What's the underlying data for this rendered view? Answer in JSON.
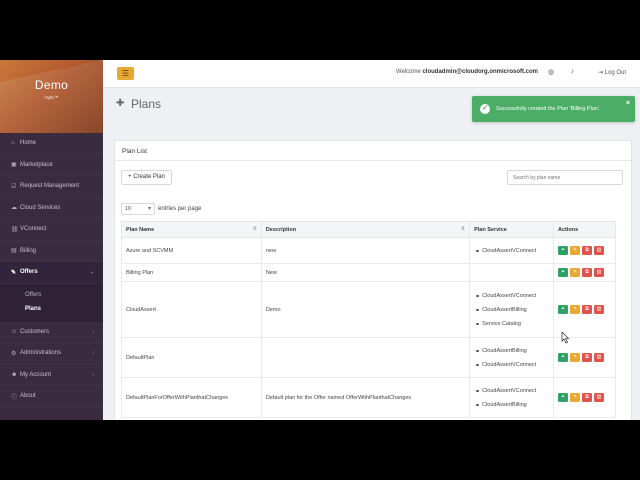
{
  "brand": {
    "title": "Demo",
    "subtitle": "Hybr™"
  },
  "sidebar": {
    "items": [
      {
        "label": "Home",
        "icon": "home-icon",
        "glyph": "⌂"
      },
      {
        "label": "Marketplace",
        "icon": "shopping-bag-icon",
        "glyph": "▣"
      },
      {
        "label": "Request Management",
        "icon": "check-square-icon",
        "glyph": "☑"
      },
      {
        "label": "Cloud Services",
        "icon": "cloud-icon",
        "glyph": "☁"
      },
      {
        "label": "VConnect",
        "icon": "link-icon",
        "glyph": "⛓"
      },
      {
        "label": "Billing",
        "icon": "billing-icon",
        "glyph": "▤"
      },
      {
        "label": "Offers",
        "icon": "tag-icon",
        "glyph": "✎"
      }
    ],
    "offers_sub": [
      "Offers",
      "Plans"
    ],
    "items_after": [
      {
        "label": "Customers",
        "icon": "users-icon",
        "glyph": "☺"
      },
      {
        "label": "Administrations",
        "icon": "admin-icon",
        "glyph": "⚙"
      },
      {
        "label": "My Account",
        "icon": "user-icon",
        "glyph": "☻"
      },
      {
        "label": "About",
        "icon": "info-icon",
        "glyph": "ⓘ"
      }
    ]
  },
  "topbar": {
    "welcome_prefix": "Welcome",
    "user": "cloudadmin@cloudorg.onmicrosoft.com",
    "logout": "Log Out"
  },
  "page": {
    "title": "Plans"
  },
  "toast": {
    "message": "Successfully created the Plan 'Billing Plan'.",
    "close": "×"
  },
  "panel": {
    "title": "Plan List",
    "create_button": "Create Plan",
    "search_placeholder": "Search by plan name",
    "entries_value": "10",
    "entries_label": "entries per page"
  },
  "table": {
    "headers": [
      "Plan Name",
      "Description",
      "Plan Service",
      "Actions"
    ],
    "rows": [
      {
        "name": "Azure and SCVMM",
        "description": "new",
        "services": [
          "CloudAssertVConnect"
        ]
      },
      {
        "name": "Billing Plan",
        "description": "New",
        "services": []
      },
      {
        "name": "CloudAssert",
        "description": "Demo",
        "services": [
          "CloudAssertVConnect",
          "CloudAssertBilling",
          "Service Catalog"
        ]
      },
      {
        "name": "DefaultPlan",
        "description": "",
        "services": [
          "CloudAssertBilling",
          "CloudAssertVConnect"
        ]
      },
      {
        "name": "DefaultPlanForOfferWithPlanthatChanges",
        "description": "Default plan for the Offer named OfferWithPlanthatChanges",
        "services": [
          "CloudAssertVConnect",
          "CloudAssertBilling"
        ]
      }
    ]
  },
  "colors": {
    "sidebar": "#3a2b3f",
    "accent": "#e8a933",
    "success": "#4cae66",
    "danger": "#e0524c",
    "link_action": "#2ea167"
  }
}
